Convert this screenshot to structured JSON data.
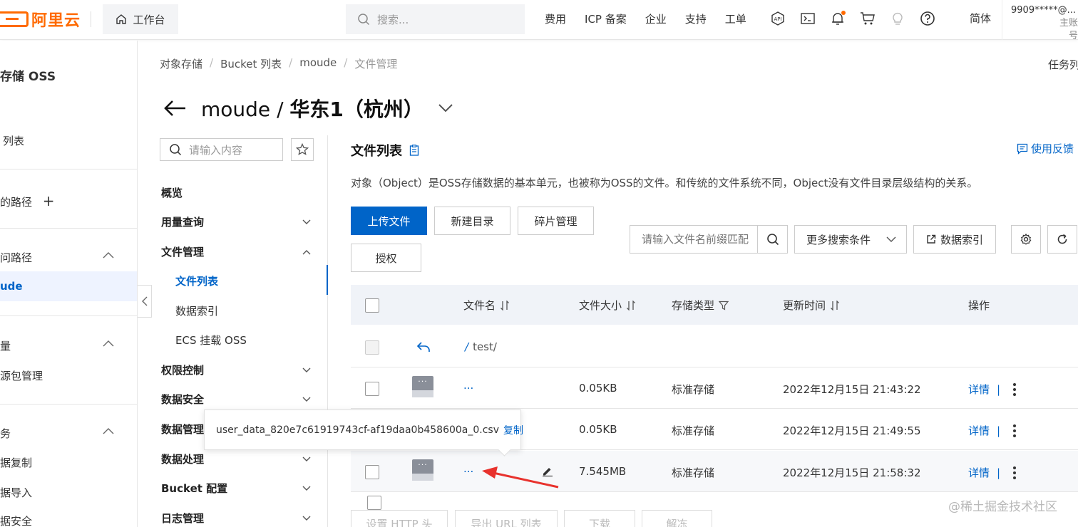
{
  "brand": {
    "logo_text": "阿里云",
    "workbench_label": "工作台"
  },
  "top_search": {
    "placeholder": "搜索..."
  },
  "top_nav": [
    "费用",
    "ICP 备案",
    "企业",
    "支持",
    "工单"
  ],
  "top_icons": [
    "api-icon",
    "terminal-icon",
    "bell-icon",
    "cart-icon",
    "lightbulb-icon",
    "help-icon"
  ],
  "language": "简体",
  "account": {
    "name": "9909*****@...",
    "role": "主账号"
  },
  "sidebar": {
    "title": "存储 OSS",
    "items": {
      "bucket_list": "列表",
      "paths": "的路径",
      "access_paths": "问路径",
      "moude": "ude",
      "usage": "量",
      "package_mgmt": "源包管理",
      "services": "务",
      "data_copy": "据复制",
      "data_import": "据导入",
      "security": "据安全"
    }
  },
  "breadcrumb": [
    "对象存储",
    "Bucket 列表",
    "moude",
    "文件管理"
  ],
  "tasks_label": "任务列",
  "page_title": {
    "bucket": "moude",
    "separator": "/",
    "region": "华东1（杭州）"
  },
  "subnav": {
    "search_placeholder": "请输入内容",
    "overview": "概览",
    "usage_query": "用量查询",
    "file_management": "文件管理",
    "file_list": "文件列表",
    "data_index": "数据索引",
    "ecs_mount": "ECS 挂载 OSS",
    "permission_control": "权限控制",
    "data_security": "数据安全",
    "data_management": "数据管理",
    "data_processing": "数据处理",
    "bucket_config": "Bucket 配置",
    "log_management": "日志管理"
  },
  "main": {
    "title": "文件列表",
    "feedback": "使用反馈",
    "description": "对象（Object）是OSS存储数据的基本单元，也被称为OSS的文件。和传统的文件系统不同，Object没有文件目录层级结构的关系。",
    "buttons": {
      "upload": "上传文件",
      "new_dir": "新建目录",
      "fragments": "碎片管理",
      "authorize": "授权"
    },
    "file_search_placeholder": "请输入文件名前缀匹配",
    "more_conditions": "更多搜索条件",
    "data_index": "数据索引"
  },
  "table": {
    "headers": {
      "name": "文件名",
      "size": "文件大小",
      "storage": "存储类型",
      "updated": "更新时间",
      "ops": "操作"
    },
    "parent": {
      "path": "test/"
    },
    "rows": [
      {
        "name": "...",
        "size": "0.05KB",
        "storage": "标准存储",
        "updated": "2022年12月15日 21:43:22",
        "detail": "详情"
      },
      {
        "name": "...",
        "size": "0.05KB",
        "storage": "标准存储",
        "updated": "2022年12月15日 21:49:55",
        "detail": "详情"
      },
      {
        "name": "...",
        "size": "7.545MB",
        "storage": "标准存储",
        "updated": "2022年12月15日 21:58:32",
        "detail": "详情"
      }
    ]
  },
  "tooltip": {
    "filename": "user_data_820e7c61919743cf-af19daa0b458600a_0.csv",
    "copy": "复制"
  },
  "bottom_buttons": [
    "设置 HTTP 头",
    "导出 URL 列表",
    "下载",
    "解冻"
  ],
  "watermark": "@稀土掘金技术社区",
  "colors": {
    "accent": "#0064c8",
    "brand": "#ff6a00",
    "annotation_arrow": "#e8322d"
  }
}
